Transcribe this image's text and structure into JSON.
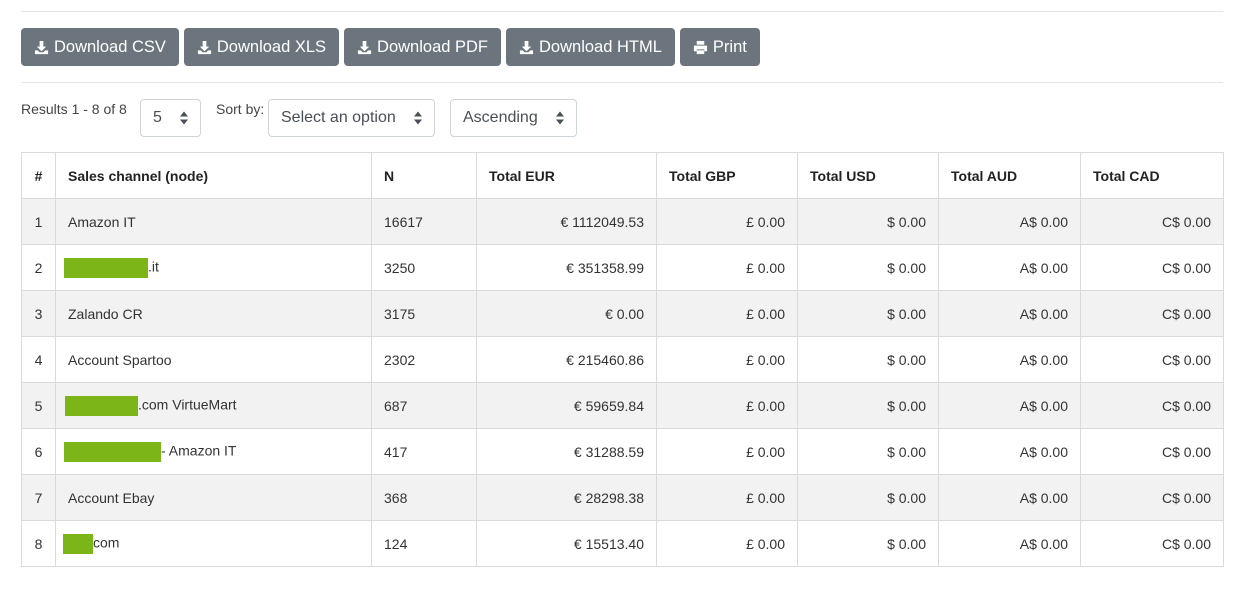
{
  "toolbar": {
    "buttons": [
      {
        "label": "Download CSV",
        "icon": "download-icon"
      },
      {
        "label": "Download XLS",
        "icon": "download-icon"
      },
      {
        "label": "Download PDF",
        "icon": "download-icon"
      },
      {
        "label": "Download HTML",
        "icon": "download-icon"
      },
      {
        "label": "Print",
        "icon": "print-icon"
      }
    ]
  },
  "filters": {
    "results_text": "Results 1 - 8 of 8",
    "page_size": "5",
    "sort_label": "Sort by:",
    "sort_placeholder": "Select an option",
    "order": "Ascending"
  },
  "table": {
    "headers": [
      "#",
      "Sales channel (node)",
      "N",
      "Total EUR",
      "Total GBP",
      "Total USD",
      "Total AUD",
      "Total CAD"
    ],
    "rows": [
      {
        "idx": "1",
        "channel": "Amazon IT",
        "n": "16617",
        "eur": "€ 1112049.53",
        "gbp": "£ 0.00",
        "usd": "$ 0.00",
        "aud": "A$ 0.00",
        "cad": "C$ 0.00"
      },
      {
        "idx": "2",
        "channel": ".it",
        "n": "3250",
        "eur": "€ 351358.99",
        "gbp": "£ 0.00",
        "usd": "$ 0.00",
        "aud": "A$ 0.00",
        "cad": "C$ 0.00"
      },
      {
        "idx": "3",
        "channel": "Zalando CR",
        "n": "3175",
        "eur": "€ 0.00",
        "gbp": "£ 0.00",
        "usd": "$ 0.00",
        "aud": "A$ 0.00",
        "cad": "C$ 0.00"
      },
      {
        "idx": "4",
        "channel": "Account Spartoo",
        "n": "2302",
        "eur": "€ 215460.86",
        "gbp": "£ 0.00",
        "usd": "$ 0.00",
        "aud": "A$ 0.00",
        "cad": "C$ 0.00"
      },
      {
        "idx": "5",
        "channel": ".com VirtueMart",
        "n": "687",
        "eur": "€ 59659.84",
        "gbp": "£ 0.00",
        "usd": "$ 0.00",
        "aud": "A$ 0.00",
        "cad": "C$ 0.00"
      },
      {
        "idx": "6",
        "channel": "- Amazon IT",
        "n": "417",
        "eur": "€ 31288.59",
        "gbp": "£ 0.00",
        "usd": "$ 0.00",
        "aud": "A$ 0.00",
        "cad": "C$ 0.00"
      },
      {
        "idx": "7",
        "channel": "Account Ebay",
        "n": "368",
        "eur": "€ 28298.38",
        "gbp": "£ 0.00",
        "usd": "$ 0.00",
        "aud": "A$ 0.00",
        "cad": "C$ 0.00"
      },
      {
        "idx": "8",
        "channel": "com",
        "n": "124",
        "eur": "€ 15513.40",
        "gbp": "£ 0.00",
        "usd": "$ 0.00",
        "aud": "A$ 0.00",
        "cad": "C$ 0.00"
      }
    ]
  },
  "colors": {
    "button_bg": "#6c757d",
    "redaction": "#7cb518",
    "stripe": "#f2f2f2",
    "border": "#dadada"
  }
}
